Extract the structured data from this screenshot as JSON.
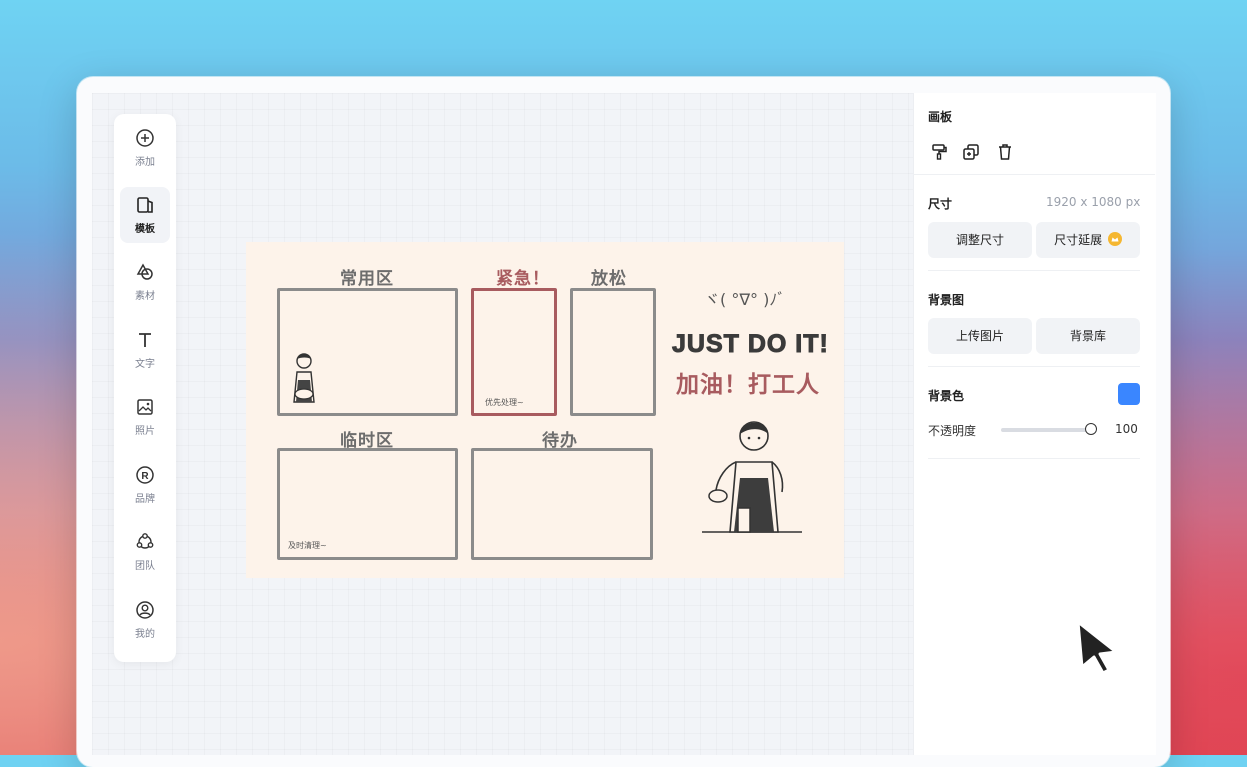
{
  "sidebar": {
    "items": [
      {
        "label": "添加",
        "icon": "plus-circle-icon"
      },
      {
        "label": "模板",
        "icon": "template-icon",
        "active": true
      },
      {
        "label": "素材",
        "icon": "shapes-icon"
      },
      {
        "label": "文字",
        "icon": "text-icon"
      },
      {
        "label": "照片",
        "icon": "photo-icon"
      },
      {
        "label": "品牌",
        "icon": "brand-icon"
      },
      {
        "label": "团队",
        "icon": "team-icon"
      },
      {
        "label": "我的",
        "icon": "user-icon"
      }
    ]
  },
  "canvas": {
    "sections": {
      "common": "常用区",
      "urgent": "紧急！",
      "relax": "放松",
      "temp": "临时区",
      "todo": "待办"
    },
    "notes": {
      "urgent_note": "优先处理~",
      "temp_note": "及时清理~"
    },
    "kaomoji": "ヾ( °∇° )ﾉﾞ",
    "slogan_en": "JUST DO IT!",
    "slogan_cn": "加油！打工人",
    "colors": {
      "background": "#fdf3ea",
      "accent": "#a85b5f"
    }
  },
  "panel": {
    "title": "画板",
    "size": {
      "label": "尺寸",
      "value": "1920 x 1080 px",
      "adjust_button": "调整尺寸",
      "extend_button": "尺寸延展"
    },
    "background_image": {
      "label": "背景图",
      "upload_button": "上传图片",
      "library_button": "背景库"
    },
    "background_color": {
      "label": "背景色",
      "color": "#3a86ff",
      "opacity_label": "不透明度",
      "opacity_value": "100"
    }
  }
}
